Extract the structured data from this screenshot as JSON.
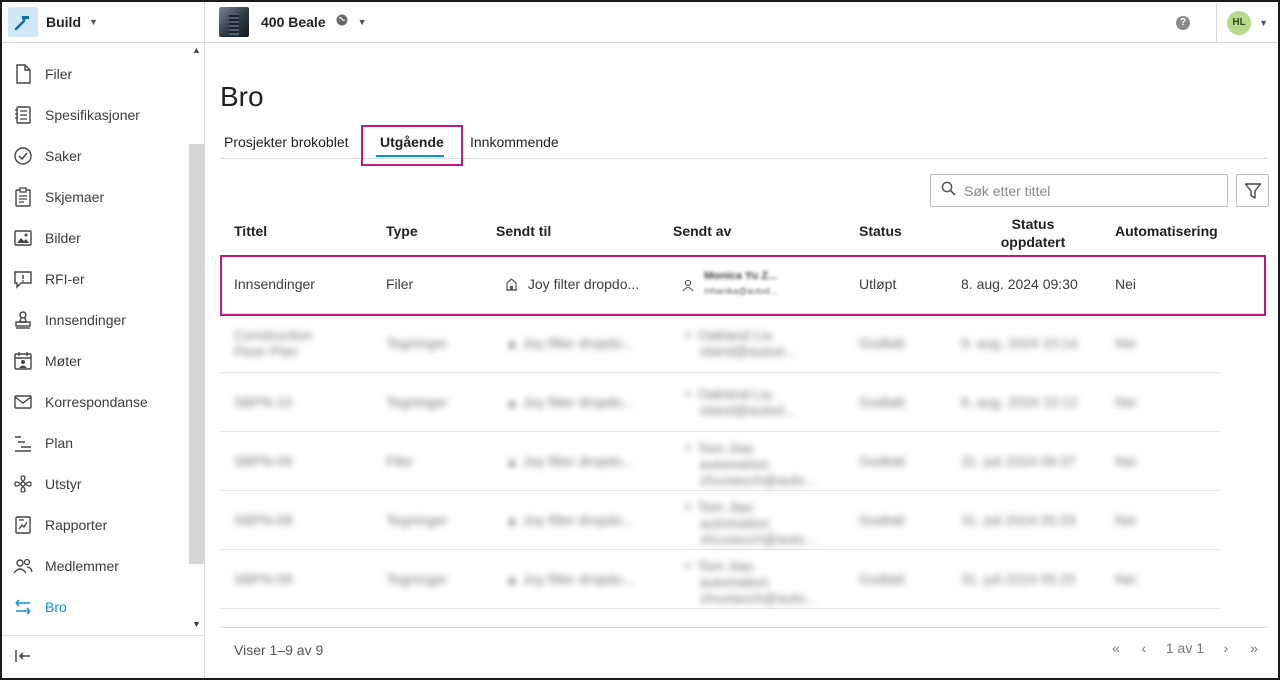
{
  "topbar": {
    "app_name": "Build",
    "project_name": "400 Beale",
    "avatar_initials": "HL"
  },
  "sidebar": {
    "items": [
      {
        "label": "Filer",
        "icon": "file-icon"
      },
      {
        "label": "Spesifikasjoner",
        "icon": "specifications-icon"
      },
      {
        "label": "Saker",
        "icon": "check-circle-icon"
      },
      {
        "label": "Skjemaer",
        "icon": "clipboard-icon"
      },
      {
        "label": "Bilder",
        "icon": "image-icon"
      },
      {
        "label": "RFI-er",
        "icon": "rfi-icon"
      },
      {
        "label": "Innsendinger",
        "icon": "stamp-icon"
      },
      {
        "label": "Møter",
        "icon": "meetings-icon"
      },
      {
        "label": "Korrespondanse",
        "icon": "envelope-icon"
      },
      {
        "label": "Plan",
        "icon": "schedule-icon"
      },
      {
        "label": "Utstyr",
        "icon": "fan-icon"
      },
      {
        "label": "Rapporter",
        "icon": "report-icon"
      },
      {
        "label": "Medlemmer",
        "icon": "members-icon"
      },
      {
        "label": "Bro",
        "icon": "bridge-icon",
        "active": true
      }
    ]
  },
  "page": {
    "title": "Bro",
    "tabs": [
      {
        "label": "Prosjekter brokoblet"
      },
      {
        "label": "Utgående",
        "active": true
      },
      {
        "label": "Innkommende"
      }
    ],
    "search_placeholder": "Søk etter tittel"
  },
  "table": {
    "headers": {
      "title": "Tittel",
      "type": "Type",
      "sent_to": "Sendt til",
      "sent_by": "Sendt av",
      "status": "Status",
      "status_updated_1": "Status",
      "status_updated_2": "oppdatert",
      "automation": "Automatisering"
    },
    "rows": [
      {
        "title": "Innsendinger",
        "title2": "",
        "type": "Filer",
        "sent_to": "Joy filter dropdo...",
        "sent_by_name": "Monica Yu Z...",
        "sent_by_sub": "mhanika@autod...",
        "sent_by_sub2": "",
        "status": "Utløpt",
        "updated": "8. aug. 2024 09:30",
        "automation": "Nei"
      },
      {
        "title": "Construction",
        "title2": "Floor Plan",
        "type": "Tegninger",
        "sent_to": "Joy filter dropdo...",
        "sent_by_name": "Oakland Liu",
        "sent_by_sub": "oland@autod...",
        "sent_by_sub2": "",
        "status": "Godtatt",
        "updated": "8. aug. 2024 10:14",
        "automation": "Nei"
      },
      {
        "title": "SBPN-10",
        "title2": "",
        "type": "Tegninger",
        "sent_to": "Joy filter dropdo...",
        "sent_by_name": "Oakland Liu",
        "sent_by_sub": "oland@autod...",
        "sent_by_sub2": "",
        "status": "Godtatt",
        "updated": "8. aug. 2024 10:12",
        "automation": "Nei"
      },
      {
        "title": "SBPN-09",
        "title2": "",
        "type": "Filer",
        "sent_to": "Joy filter dropdo...",
        "sent_by_name": "Tom Jiao",
        "sent_by_sub": "automation",
        "sent_by_sub2": "zhuxiaoch@auto...",
        "status": "Godtatt",
        "updated": "31. juli 2024 09:37",
        "automation": "Nei"
      },
      {
        "title": "SBPN-08",
        "title2": "",
        "type": "Tegninger",
        "sent_to": "Joy filter dropdo...",
        "sent_by_name": "Tom Jiao",
        "sent_by_sub": "automation",
        "sent_by_sub2": "zhuxiaoch@auto...",
        "status": "Godtatt",
        "updated": "31. juli 2024 05:29",
        "automation": "Nei"
      },
      {
        "title": "SBPN-08",
        "title2": "",
        "type": "Tegninger",
        "sent_to": "Joy filter dropdo...",
        "sent_by_name": "Tom Jiao",
        "sent_by_sub": "automation",
        "sent_by_sub2": "zhuxiaoch@auto...",
        "status": "Godtatt",
        "updated": "31. juli 2024 05:25",
        "automation": "Nei"
      }
    ]
  },
  "footer": {
    "count_text": "Viser 1–9 av",
    "total": "9",
    "page_text": "1 av 1"
  },
  "colors": {
    "accent": "#0696d7",
    "highlight": "#c2187a"
  }
}
